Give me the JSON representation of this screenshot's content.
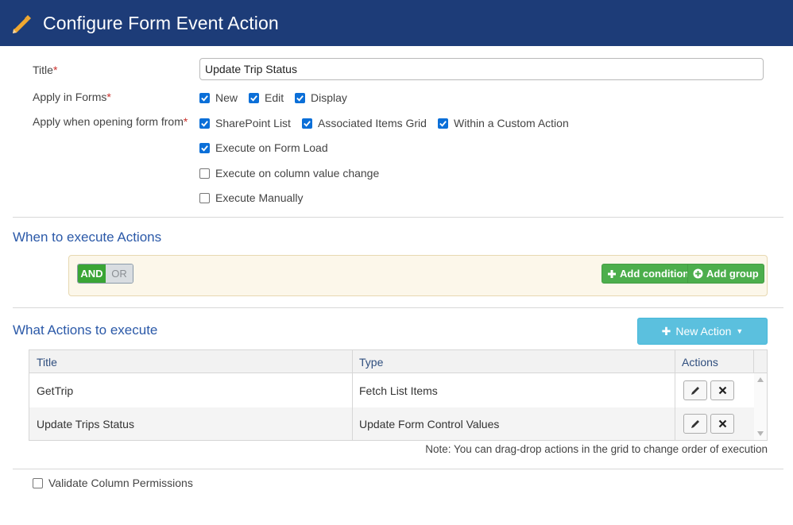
{
  "header": {
    "title": "Configure Form Event Action",
    "icon": "pencil-icon"
  },
  "form": {
    "title_label": "Title",
    "title_value": "Update Trip Status",
    "apply_forms_label": "Apply in Forms",
    "apply_forms": [
      {
        "label": "New",
        "checked": true
      },
      {
        "label": "Edit",
        "checked": true
      },
      {
        "label": "Display",
        "checked": true
      }
    ],
    "apply_from_label": "Apply when opening form from",
    "apply_from": [
      {
        "label": "SharePoint List",
        "checked": true
      },
      {
        "label": "Associated Items Grid",
        "checked": true
      },
      {
        "label": "Within a Custom Action",
        "checked": true
      }
    ],
    "execute_options": [
      {
        "label": "Execute on Form Load",
        "checked": true
      },
      {
        "label": "Execute on column value change",
        "checked": false
      },
      {
        "label": "Execute Manually",
        "checked": false
      }
    ],
    "required_mark": "*"
  },
  "when": {
    "title": "When to execute Actions",
    "and_label": "AND",
    "or_label": "OR",
    "add_condition": "Add condition",
    "add_group": "Add group"
  },
  "what": {
    "title": "What Actions to execute",
    "new_action": "New Action",
    "columns": [
      "Title",
      "Type",
      "Actions"
    ],
    "rows": [
      {
        "title": "GetTrip",
        "type": "Fetch List Items"
      },
      {
        "title": "Update Trips Status",
        "type": "Update Form Control Values"
      }
    ],
    "note": "Note: You can drag-drop actions in the grid to change order of execution"
  },
  "validate": {
    "label": "Validate Column Permissions",
    "checked": false
  },
  "colors": {
    "header": "#1d3c78",
    "accent": "#2b59a8",
    "green": "#4cae4c",
    "info": "#5bc0de"
  }
}
